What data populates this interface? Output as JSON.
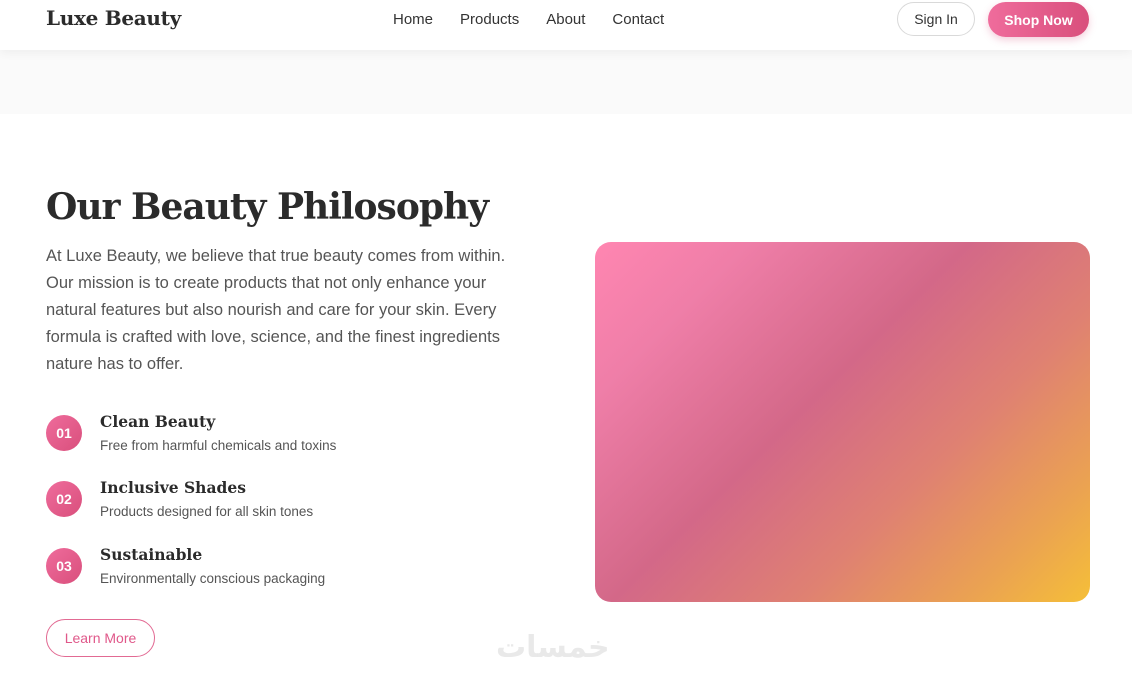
{
  "header": {
    "brand": "Luxe Beauty",
    "nav": [
      "Home",
      "Products",
      "About",
      "Contact"
    ],
    "sign_in_label": "Sign In",
    "shop_now_label": "Shop Now"
  },
  "philosophy": {
    "title": "Our Beauty Philosophy",
    "description": "At Luxe Beauty, we believe that true beauty comes from within. Our mission is to create products that not only enhance your natural features but also nourish and care for your skin. Every formula is crafted with love, science, and the finest ingredients nature has to offer.",
    "features": [
      {
        "number": "01",
        "title": "Clean Beauty",
        "description": "Free from harmful chemicals and toxins"
      },
      {
        "number": "02",
        "title": "Inclusive Shades",
        "description": "Products designed for all skin tones"
      },
      {
        "number": "03",
        "title": "Sustainable",
        "description": "Environmentally conscious packaging"
      }
    ],
    "learn_more_label": "Learn More"
  },
  "watermark": "خمسات",
  "colors": {
    "accent": "#e0588a",
    "accent_gradient_start": "#ef6c9c",
    "accent_gradient_end": "#d94f7c",
    "image_gradient": [
      "#ff86b1",
      "#d36888",
      "#f5bf38"
    ]
  }
}
